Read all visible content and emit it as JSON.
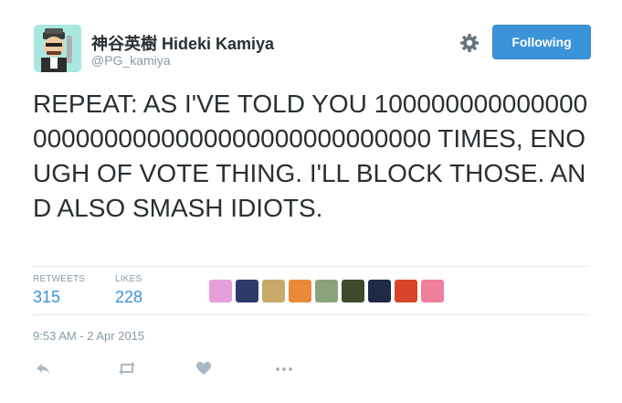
{
  "user": {
    "fullname": "神谷英樹 Hideki Kamiya",
    "handle": "@PG_kamiya",
    "follow_label": "Following"
  },
  "tweet": {
    "text": "REPEAT: AS I'VE TOLD YOU 1000000000000000000000000000000000000000000 TIMES, ENOUGH OF VOTE THING. I'LL BLOCK THOSE. AND ALSO SMASH IDIOTS."
  },
  "stats": {
    "retweets_label": "RETWEETS",
    "retweets_value": "315",
    "likes_label": "LIKES",
    "likes_value": "228"
  },
  "likers": [
    {
      "name": "liker-avatar-1",
      "color": "#e6a0d8"
    },
    {
      "name": "liker-avatar-2",
      "color": "#2d3a6b"
    },
    {
      "name": "liker-avatar-3",
      "color": "#c8a86b"
    },
    {
      "name": "liker-avatar-4",
      "color": "#e98a3a"
    },
    {
      "name": "liker-avatar-5",
      "color": "#8aa37a"
    },
    {
      "name": "liker-avatar-6",
      "color": "#3f4a2a"
    },
    {
      "name": "liker-avatar-7",
      "color": "#1f2b44"
    },
    {
      "name": "liker-avatar-8",
      "color": "#d7452b"
    },
    {
      "name": "liker-avatar-9",
      "color": "#ef7f9b"
    }
  ],
  "timestamp": "9:53 AM - 2 Apr 2015",
  "actions": [
    "reply-icon",
    "retweet-icon",
    "like-icon",
    "more-icon"
  ],
  "colors": {
    "accent": "#3b94d9",
    "muted": "#8899a6",
    "avatar_bg": "#a9e8e0"
  }
}
